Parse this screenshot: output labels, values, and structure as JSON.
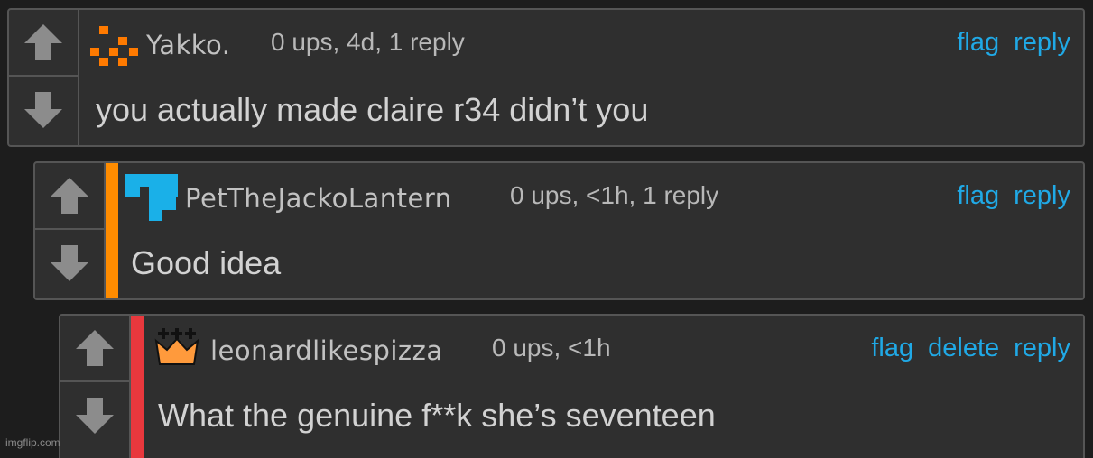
{
  "comments": [
    {
      "username": "Yakko.",
      "meta": "0 ups, 4d, 1 reply",
      "actions": [
        "flag",
        "reply"
      ],
      "text": "you actually made claire r34 didn’t you"
    },
    {
      "username": "PetTheJackoLantern",
      "meta": "0 ups, <1h, 1 reply",
      "actions": [
        "flag",
        "reply"
      ],
      "text": "Good idea"
    },
    {
      "username": "leonardlikespizza",
      "meta": "0 ups, <1h",
      "actions": [
        "flag",
        "delete",
        "reply"
      ],
      "text": "What the genuine f**k she’s seventeen"
    }
  ],
  "watermark": "imgflip.com",
  "colors": {
    "thread_bar_2": "#ff8c00",
    "thread_bar_3": "#e8383d",
    "link": "#20a9e6",
    "avatar_1": "#ff7a00",
    "avatar_2": "#1ab0e8",
    "avatar_3": "#ff9a3c"
  },
  "icons": {
    "upvote": "arrow-up-icon",
    "downvote": "arrow-down-icon"
  }
}
